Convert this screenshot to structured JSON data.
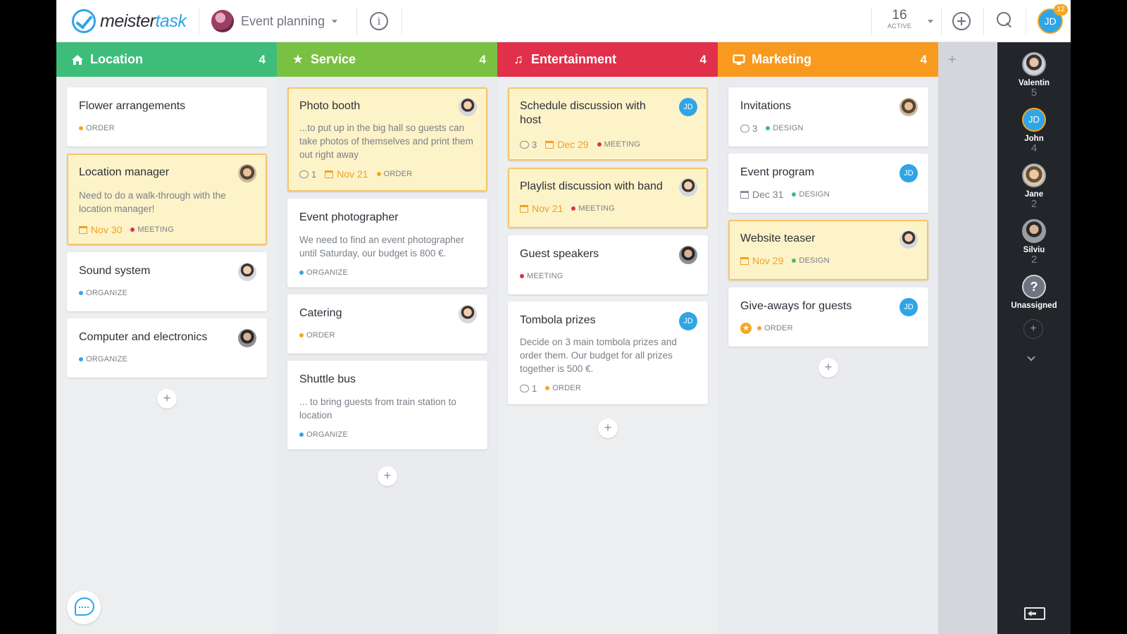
{
  "topbar": {
    "logo_part1": "meister",
    "logo_part2": "task",
    "project_name": "Event planning",
    "active_count": "16",
    "active_label": "ACTIVE",
    "user_initials": "JD",
    "notification_count": "12"
  },
  "columns": [
    {
      "title": "Location",
      "count": "4",
      "color": "#3ebd7a",
      "icon": "home-icon",
      "cards": [
        {
          "title": "Flower arrangements",
          "tag": "ORDER",
          "tag_color": "#f5a623"
        },
        {
          "title": "Location manager",
          "desc": "Need to do a walk-through with the location manager!",
          "due": "Nov 30",
          "tag": "MEETING",
          "tag_color": "#e0304a"
        },
        {
          "title": "Sound system",
          "tag": "ORGANIZE",
          "tag_color": "#2fa5e6"
        },
        {
          "title": "Computer and electronics",
          "tag": "ORGANIZE",
          "tag_color": "#2fa5e6"
        }
      ]
    },
    {
      "title": "Service",
      "count": "4",
      "color": "#7ac143",
      "icon": "star-icon",
      "cards": [
        {
          "title": "Photo booth",
          "desc": "...to put up in the big hall so guests can take photos of themselves and print them out right away",
          "comments": "1",
          "due": "Nov 21",
          "tag": "ORDER",
          "tag_color": "#f5a623"
        },
        {
          "title": "Event photographer",
          "desc": "We need to find an event photographer until Saturday, our budget is 800 €.",
          "tag": "ORGANIZE",
          "tag_color": "#2fa5e6"
        },
        {
          "title": "Catering",
          "tag": "ORDER",
          "tag_color": "#f5a623"
        },
        {
          "title": "Shuttle bus",
          "desc": "... to bring guests from train station to location",
          "tag": "ORGANIZE",
          "tag_color": "#2fa5e6"
        }
      ]
    },
    {
      "title": "Entertainment",
      "count": "4",
      "color": "#e0304a",
      "icon": "music-note-icon",
      "cards": [
        {
          "title": "Schedule discussion with host",
          "comments": "3",
          "due": "Dec 29",
          "tag": "MEETING",
          "tag_color": "#e0304a",
          "assignee": "JD"
        },
        {
          "title": "Playlist discussion with band",
          "due": "Nov 21",
          "tag": "MEETING",
          "tag_color": "#e0304a"
        },
        {
          "title": "Guest speakers",
          "tag": "MEETING",
          "tag_color": "#e0304a"
        },
        {
          "title": "Tombola prizes",
          "desc": "Decide on 3 main tombola prizes and order them. Our budget for all prizes together is 500 €.",
          "comments": "1",
          "tag": "ORDER",
          "tag_color": "#f5a623",
          "assignee": "JD"
        }
      ]
    },
    {
      "title": "Marketing",
      "count": "4",
      "color": "#f79a1e",
      "icon": "monitor-icon",
      "cards": [
        {
          "title": "Invitations",
          "comments": "3",
          "tag": "DESIGN",
          "tag_color": "#3ebd7a"
        },
        {
          "title": "Event program",
          "due": "Dec 31",
          "tag": "DESIGN",
          "tag_color": "#3ebd7a",
          "assignee": "JD"
        },
        {
          "title": "Website teaser",
          "due": "Nov 29",
          "tag": "DESIGN",
          "tag_color": "#3ebd7a"
        },
        {
          "title": "Give-aways for guests",
          "tag": "ORDER",
          "tag_color": "#f5a623",
          "assignee": "JD"
        }
      ]
    }
  ],
  "people": [
    {
      "name": "Valentin",
      "count": "5"
    },
    {
      "name": "John",
      "count": "4",
      "initials": "JD"
    },
    {
      "name": "Jane",
      "count": "2"
    },
    {
      "name": "Silviu",
      "count": "2"
    },
    {
      "name": "Unassigned",
      "symbol": "?"
    }
  ],
  "add_symbol": "+"
}
